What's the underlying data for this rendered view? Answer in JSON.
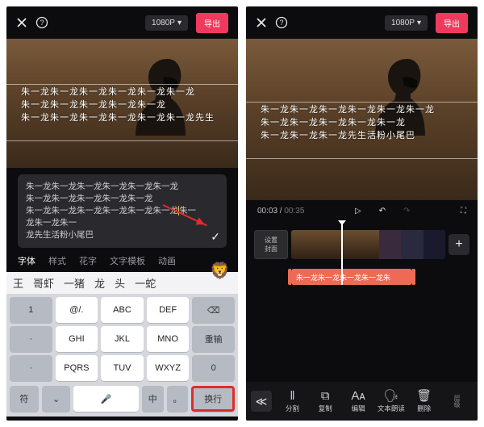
{
  "topbar": {
    "resolution": "1080P",
    "export": "导出"
  },
  "overlay": {
    "line1": "朱一龙朱一龙朱一龙朱一龙朱一龙朱一龙",
    "line2": "朱一龙朱一龙朱一龙朱一龙朱一龙",
    "line3": "朱一龙朱一龙朱一龙朱一龙朱一龙朱一龙先生"
  },
  "overlay_right": {
    "line1": "朱一龙朱一龙朱一龙朱一龙朱一龙朱一龙",
    "line2": "朱一龙朱一龙朱一龙朱一龙朱一龙",
    "line3": "朱一龙朱一龙朱一龙先生活粉小尾巴"
  },
  "input": {
    "l1": "朱一龙朱一龙朱一龙朱一龙朱一龙朱一龙",
    "l2": "朱一龙朱一龙朱一龙朱一龙朱一龙",
    "l3a": "朱一龙朱一龙朱一龙朱一龙朱一龙朱一龙",
    "l3b": "朱一龙朱一龙朱一",
    "l4": "龙先生活粉小尾巴"
  },
  "tabs": {
    "t1": "字体",
    "t2": "样式",
    "t3": "花字",
    "t4": "文字模板",
    "t5": "动画"
  },
  "sugg": {
    "s1": "王",
    "s2": "哥虾",
    "s3": "一猪",
    "s4": "龙",
    "s5": "头",
    "s6": "一蛇",
    "emoji": "🦁"
  },
  "keys": {
    "r1": [
      "@/.",
      "ABC",
      "DEF"
    ],
    "r2": [
      "GHI",
      "JKL",
      "MNO"
    ],
    "r3": [
      "PQRS",
      "TUV",
      "WXYZ"
    ],
    "num": "1",
    "reset": "重输",
    "zero": "0",
    "sym": "符",
    "zh": "中",
    "pt": "。",
    "enter": "换行",
    "mic": "🎤"
  },
  "time": {
    "cur": "00:03",
    "dur": "00:35"
  },
  "cover": "设置\n封面",
  "texttrack": "朱一龙朱一龙朱一龙朱一龙朱",
  "tools": {
    "t1": "分割",
    "t2": "复制",
    "t3": "编辑",
    "t4": "文本朗读",
    "t5": "删除",
    "t6": "层级"
  }
}
